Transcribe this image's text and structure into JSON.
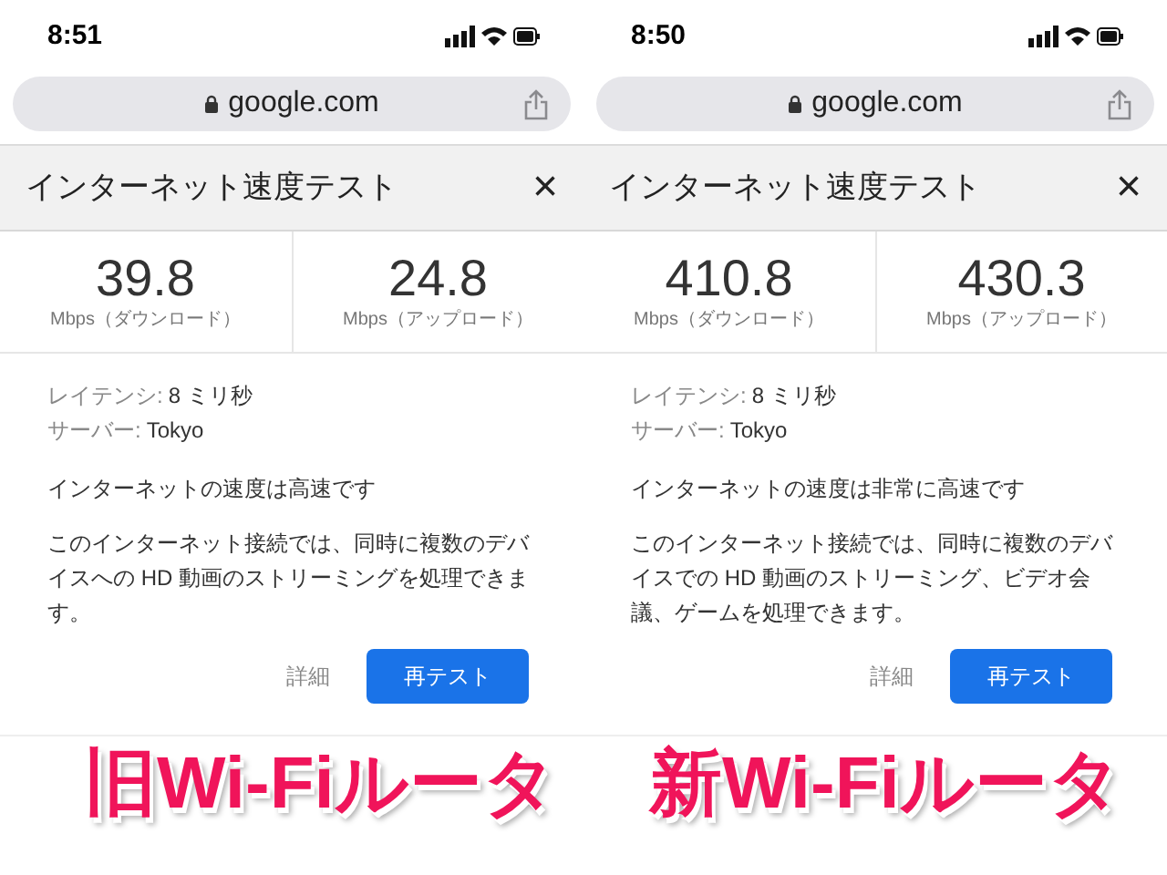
{
  "panels": [
    {
      "status_bar": {
        "time": "8:51"
      },
      "address_bar": {
        "url": "google.com"
      },
      "card": {
        "title": "インターネット速度テスト",
        "close": "×",
        "speeds": [
          {
            "value": "39.8",
            "unit": "Mbps（ダウンロード）"
          },
          {
            "value": "24.8",
            "unit": "Mbps（アップロード）"
          }
        ],
        "latency": {
          "label": "レイテンシ:",
          "value": "8 ミリ秒"
        },
        "server": {
          "label": "サーバー:",
          "value": "Tokyo"
        },
        "verdict": "インターネットの速度は高速です",
        "description": "このインターネット接続では、同時に複数のデバイスへの HD 動画のストリーミングを処理できます。",
        "buttons": [
          {
            "label": "詳細",
            "kind": "text"
          },
          {
            "label": "再テスト",
            "kind": "primary"
          }
        ]
      },
      "caption": "旧Wi-Fiルータ"
    },
    {
      "status_bar": {
        "time": "8:50"
      },
      "address_bar": {
        "url": "google.com"
      },
      "card": {
        "title": "インターネット速度テスト",
        "close": "×",
        "speeds": [
          {
            "value": "410.8",
            "unit": "Mbps（ダウンロード）"
          },
          {
            "value": "430.3",
            "unit": "Mbps（アップロード）"
          }
        ],
        "latency": {
          "label": "レイテンシ:",
          "value": "8 ミリ秒"
        },
        "server": {
          "label": "サーバー:",
          "value": "Tokyo"
        },
        "verdict": "インターネットの速度は非常に高速です",
        "description": "このインターネット接続では、同時に複数のデバイスでの HD 動画のストリーミング、ビデオ会議、ゲームを処理できます。",
        "buttons": [
          {
            "label": "詳細",
            "kind": "text"
          },
          {
            "label": "再テスト",
            "kind": "primary"
          }
        ]
      },
      "caption": "新Wi-Fiルータ"
    }
  ]
}
